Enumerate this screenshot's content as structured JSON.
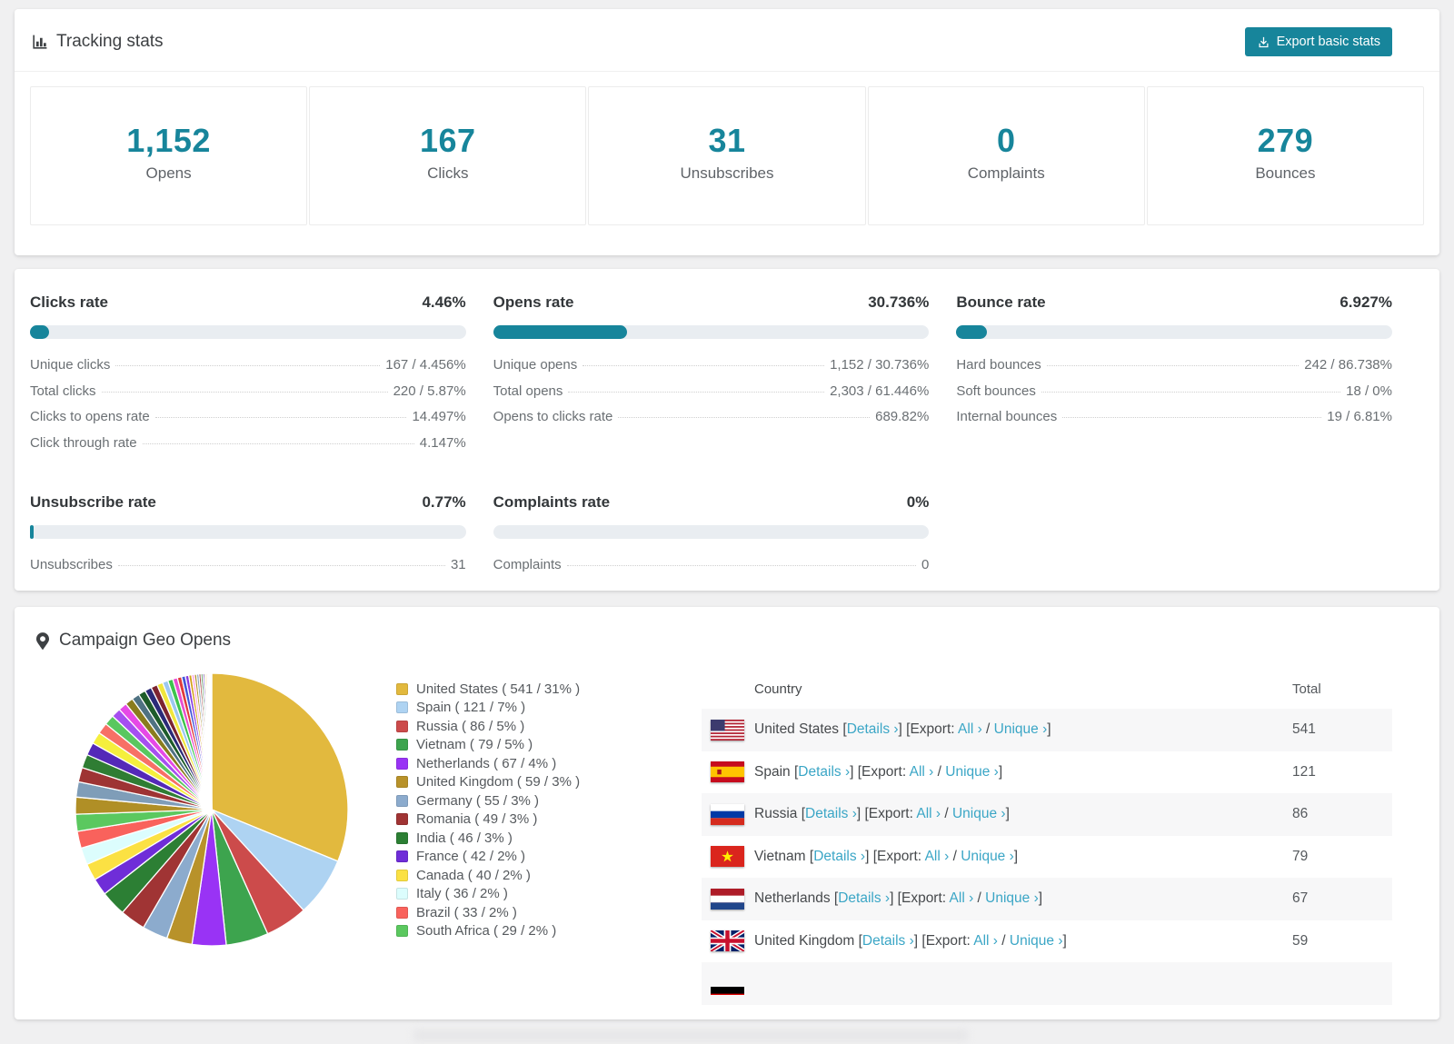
{
  "colors": {
    "accent_teal": "#17859b",
    "link_teal": "#3ba6c6",
    "track_gray": "#e9edf1"
  },
  "tracking": {
    "title": "Tracking stats",
    "export_button": "Export basic stats",
    "stats": [
      {
        "value": "1,152",
        "label": "Opens"
      },
      {
        "value": "167",
        "label": "Clicks"
      },
      {
        "value": "31",
        "label": "Unsubscribes"
      },
      {
        "value": "0",
        "label": "Complaints"
      },
      {
        "value": "279",
        "label": "Bounces"
      }
    ]
  },
  "rates": {
    "blocks": [
      {
        "title": "Clicks rate",
        "value": "4.46%",
        "pct": 4.46,
        "rows": [
          {
            "label": "Unique clicks",
            "value": "167 / 4.456%"
          },
          {
            "label": "Total clicks",
            "value": "220 / 5.87%"
          },
          {
            "label": "Clicks to opens rate",
            "value": "14.497%"
          },
          {
            "label": "Click through rate",
            "value": "4.147%"
          }
        ]
      },
      {
        "title": "Opens rate",
        "value": "30.736%",
        "pct": 30.736,
        "rows": [
          {
            "label": "Unique opens",
            "value": "1,152 / 30.736%"
          },
          {
            "label": "Total opens",
            "value": "2,303 / 61.446%"
          },
          {
            "label": "Opens to clicks rate",
            "value": "689.82%"
          }
        ]
      },
      {
        "title": "Bounce rate",
        "value": "6.927%",
        "pct": 6.927,
        "rows": [
          {
            "label": "Hard bounces",
            "value": "242 / 86.738%"
          },
          {
            "label": "Soft bounces",
            "value": "18 / 0%"
          },
          {
            "label": "Internal bounces",
            "value": "19 / 6.81%"
          }
        ]
      },
      {
        "title": "Unsubscribe rate",
        "value": "0.77%",
        "pct": 0.77,
        "rows": [
          {
            "label": "Unsubscribes",
            "value": "31"
          }
        ]
      },
      {
        "title": "Complaints rate",
        "value": "0%",
        "pct": 0,
        "rows": [
          {
            "label": "Complaints",
            "value": "0"
          }
        ]
      }
    ]
  },
  "geo": {
    "title": "Campaign Geo Opens",
    "table": {
      "headers": [
        "Country",
        "Total"
      ],
      "link_labels": {
        "details": "Details",
        "export": "Export:",
        "all": "All",
        "unique": "Unique"
      },
      "rows": [
        {
          "flag": "us",
          "country": "United States",
          "total": "541"
        },
        {
          "flag": "es",
          "country": "Spain",
          "total": "121"
        },
        {
          "flag": "ru",
          "country": "Russia",
          "total": "86"
        },
        {
          "flag": "vn",
          "country": "Vietnam",
          "total": "79"
        },
        {
          "flag": "nl",
          "country": "Netherlands",
          "total": "67"
        },
        {
          "flag": "gb",
          "country": "United Kingdom",
          "total": "59"
        },
        {
          "flag": "de",
          "country": "",
          "total": "",
          "partial": true
        }
      ]
    }
  },
  "chart_data": {
    "type": "pie",
    "title": "Campaign Geo Opens",
    "legend_position": "right",
    "start_angle_deg": -90,
    "direction": "clockwise",
    "entries": [
      {
        "name": "United States",
        "value": 541,
        "percent": 31,
        "color": "#e2b93e"
      },
      {
        "name": "Spain",
        "value": 121,
        "percent": 7,
        "color": "#aed3f2"
      },
      {
        "name": "Russia",
        "value": 86,
        "percent": 5,
        "color": "#cc4b4b"
      },
      {
        "name": "Vietnam",
        "value": 79,
        "percent": 5,
        "color": "#3da44e"
      },
      {
        "name": "Netherlands",
        "value": 67,
        "percent": 4,
        "color": "#9933f5"
      },
      {
        "name": "United Kingdom",
        "value": 59,
        "percent": 3,
        "color": "#b8922a"
      },
      {
        "name": "Germany",
        "value": 55,
        "percent": 3,
        "color": "#8cabcd"
      },
      {
        "name": "Romania",
        "value": 49,
        "percent": 3,
        "color": "#a03434"
      },
      {
        "name": "India",
        "value": 46,
        "percent": 3,
        "color": "#2c7f34"
      },
      {
        "name": "France",
        "value": 42,
        "percent": 2,
        "color": "#6f2dd8"
      },
      {
        "name": "Canada",
        "value": 40,
        "percent": 2,
        "color": "#fbe143"
      },
      {
        "name": "Italy",
        "value": 36,
        "percent": 2,
        "color": "#dcfdfd"
      },
      {
        "name": "Brazil",
        "value": 33,
        "percent": 2,
        "color": "#f9625c"
      },
      {
        "name": "South Africa",
        "value": 29,
        "percent": 2,
        "color": "#5bc85f"
      }
    ],
    "others_percent_total": 26,
    "others_slices": [
      2.0,
      1.8,
      1.7,
      1.6,
      1.5,
      1.4,
      1.3,
      1.2,
      1.1,
      1.0,
      0.95,
      0.9,
      0.85,
      0.8,
      0.75,
      0.7,
      0.65,
      0.6,
      0.55,
      0.5,
      0.45,
      0.4,
      0.35,
      0.3,
      0.28,
      0.26,
      0.24,
      0.22,
      0.2,
      0.18,
      0.16,
      0.14,
      0.12,
      0.1,
      0.08,
      0.06
    ],
    "others_palette": [
      "#b08f26",
      "#7f9db8",
      "#9e3434",
      "#2f7d33",
      "#5429b8",
      "#f5ef3d",
      "#f77066",
      "#59c75f",
      "#a64ff0",
      "#e649e6",
      "#8a7c1e",
      "#4f7282",
      "#1e5c2a",
      "#2a2a78",
      "#7c2430",
      "#f0e63c",
      "#9cc8f0",
      "#3dc44d",
      "#e94fd0",
      "#e03b3b",
      "#4357d9",
      "#8a3be0",
      "#d4a017",
      "#fb9fe3"
    ]
  }
}
